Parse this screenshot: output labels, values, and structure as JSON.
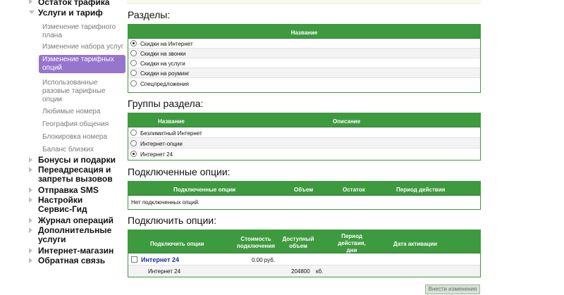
{
  "sidebar": {
    "top_cut": "Остаток трафика",
    "tariff_group": "Услуги и тариф",
    "sub_items": [
      "Изменение тарифного плана",
      "Изменение набора услуг",
      "Изменение тарифных опций",
      "Использованные разовые тарифные опции",
      "Любимые номера",
      "География общения",
      "Блокировка номера",
      "Баланс близких"
    ],
    "main_items": [
      "Бонусы и подарки",
      "Переадресация и запреты вызовов",
      "Отправка SMS",
      "Настройки Сервис-Гид",
      "Журнал операций",
      "Дополнительные услуги",
      "Интернет-магазин",
      "Обратная связь"
    ]
  },
  "sections": {
    "title": "Разделы:",
    "header": "Название",
    "items": [
      "Скидки на Интернет",
      "Скидки на звонки",
      "Скидки на услуги",
      "Скидки на роуминг",
      "Спецпредложения"
    ]
  },
  "groups": {
    "title": "Группы раздела:",
    "col_name": "Название",
    "col_desc": "Описание",
    "items": [
      "Безлимитный Интернет",
      "Интернет-опции",
      "Интернет 24"
    ]
  },
  "connected": {
    "title": "Подключенные опции:",
    "cols": [
      "Подключенные опции",
      "Объем",
      "Остаток",
      "Период действия"
    ],
    "empty": "Нет подключенных опций."
  },
  "connect": {
    "title": "Подключить опции:",
    "cols": [
      "Подключить опции",
      "Стоимость подключения",
      "Доступный объем",
      "Период действия, дни",
      "Дата активации"
    ],
    "option_name": "Интернет 24",
    "option_price": "0.00 руб.",
    "sub_name": "Интернет 24",
    "sub_volume": "204800",
    "sub_unit": "кб."
  },
  "apply_button": "Внести изменения"
}
